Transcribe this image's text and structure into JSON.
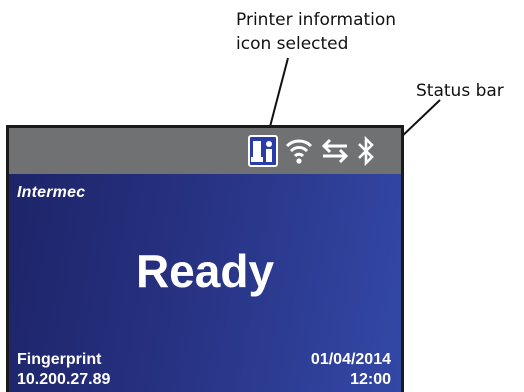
{
  "callouts": {
    "printer_info": "Printer information\nicon selected",
    "status_bar": "Status bar"
  },
  "status_bar": {
    "icons": [
      "printer-information-icon",
      "wifi-icon",
      "network-transfer-icon",
      "bluetooth-icon"
    ],
    "background_color": "#6f7173",
    "selected_icon": "printer-information-icon"
  },
  "screen": {
    "logo": "Intermec",
    "status_text": "Ready",
    "language": "Fingerprint",
    "ip_address": "10.200.27.89",
    "date": "01/04/2014",
    "time": "12:00",
    "background_color": "#26307f"
  }
}
